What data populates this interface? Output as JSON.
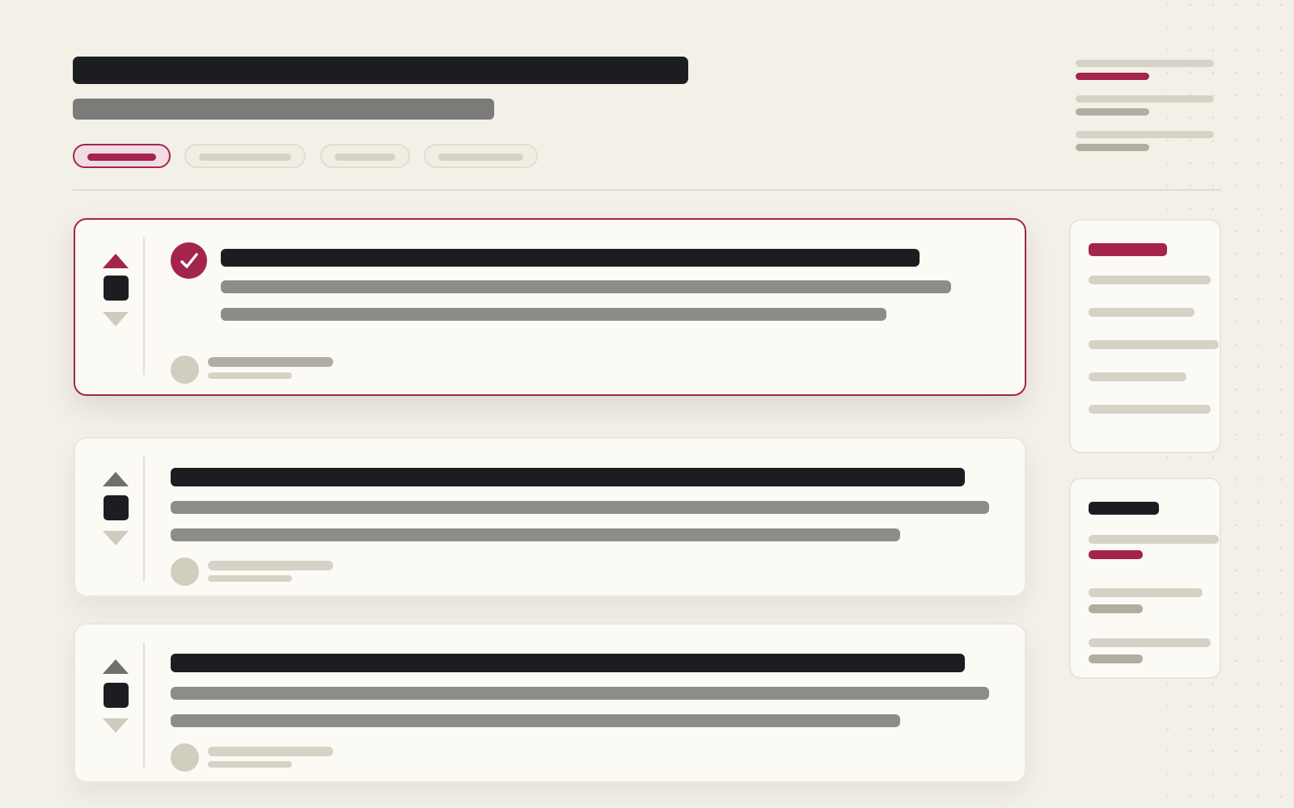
{
  "header": {
    "title": "",
    "subtitle": "",
    "tabs": [
      {
        "label": "",
        "active": true
      },
      {
        "label": "",
        "active": false
      },
      {
        "label": "",
        "active": false
      },
      {
        "label": "",
        "active": false
      }
    ]
  },
  "meta": {
    "lines": 3
  },
  "posts": [
    {
      "title": "",
      "body": "",
      "author": "",
      "selected": true,
      "accepted": true
    },
    {
      "title": "",
      "body": "",
      "author": "",
      "selected": false,
      "accepted": false
    },
    {
      "title": "",
      "body": "",
      "author": "",
      "selected": false,
      "accepted": false
    }
  ],
  "sidebar": {
    "panels": [
      {
        "heading": "",
        "items": 5
      },
      {
        "heading": "",
        "items": 3
      }
    ]
  },
  "icons": {
    "vote_up": "chevron-up-icon",
    "vote_down": "chevron-down-icon",
    "accepted": "check-circle-icon",
    "avatar": "user-avatar"
  },
  "colors": {
    "background": "#f3f0e8",
    "accent": "#a3244d",
    "text_dark": "#1c1d21",
    "card": "#fbfaf5"
  }
}
